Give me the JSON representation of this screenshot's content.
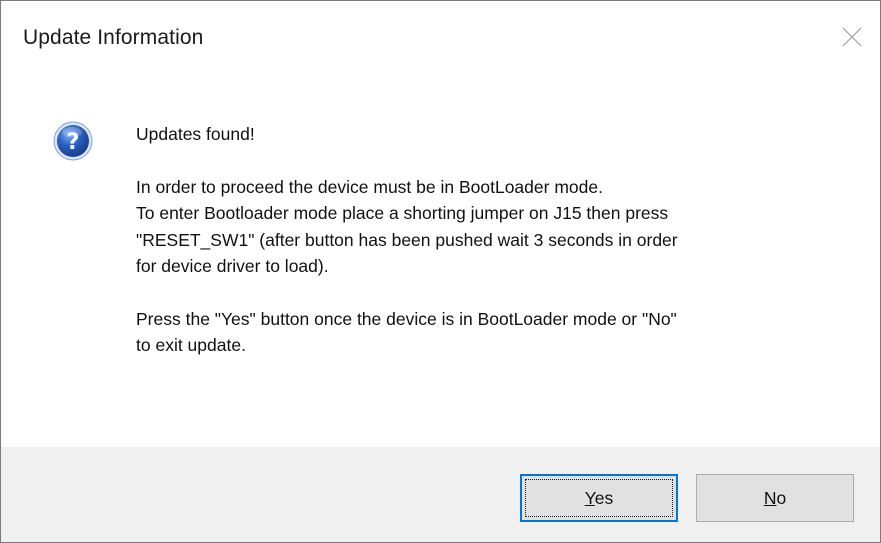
{
  "window": {
    "title": "Update Information",
    "close_icon": "close-icon"
  },
  "message": {
    "icon": "question-icon",
    "headline": "Updates found!",
    "paragraph_1": [
      "In order to proceed the device must be in BootLoader mode.",
      "To enter Bootloader mode place a shorting jumper on J15 then press",
      "\"RESET_SW1\" (after button has been pushed wait 3 seconds in order",
      "for device driver to load)."
    ],
    "paragraph_2": [
      "Press the \"Yes\" button once the device is in BootLoader mode or \"No\"",
      "to exit update."
    ]
  },
  "buttons": {
    "yes": {
      "mnemonic": "Y",
      "rest": "es",
      "default": true
    },
    "no": {
      "mnemonic": "N",
      "rest": "o",
      "default": false
    }
  },
  "colors": {
    "focus_border": "#0078d7",
    "button_face": "#e1e1e1",
    "footer_bg": "#f0f0f0",
    "icon_blue": "#1f4fa3"
  }
}
